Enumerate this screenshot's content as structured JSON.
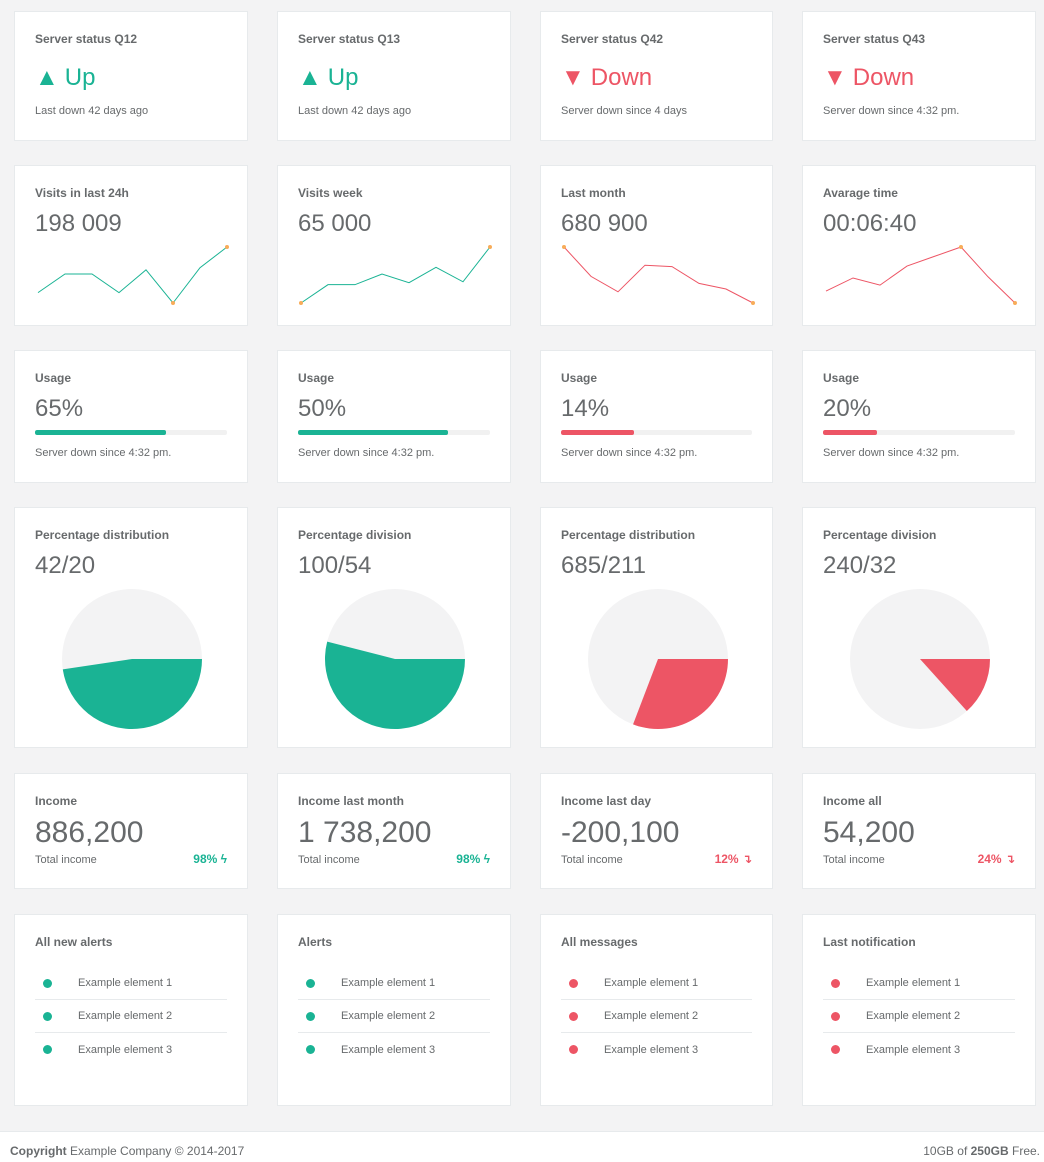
{
  "colors": {
    "up": "#1ab394",
    "down": "#ed5565",
    "dot": "#f8ac59",
    "track": "#f1f1f1",
    "pie_bg": "#f3f3f4"
  },
  "status": [
    {
      "title": "Server status Q12",
      "state": "Up",
      "dir": "up",
      "note": "Last down 42 days ago"
    },
    {
      "title": "Server status Q13",
      "state": "Up",
      "dir": "up",
      "note": "Last down 42 days ago"
    },
    {
      "title": "Server status Q42",
      "state": "Down",
      "dir": "down",
      "note": "Server down since 4 days"
    },
    {
      "title": "Server status Q43",
      "state": "Down",
      "dir": "down",
      "note": "Server down since 4:32 pm."
    }
  ],
  "visits": [
    {
      "title": "Visits in last 24h",
      "value": "198 009",
      "dir": "up",
      "points": [
        34,
        43,
        43,
        34,
        45,
        29,
        46,
        56
      ]
    },
    {
      "title": "Visits week",
      "value": "65 000",
      "dir": "up",
      "points": [
        24,
        43,
        43,
        54,
        45,
        61,
        46,
        82
      ]
    },
    {
      "title": "Last month",
      "value": "680 900",
      "dir": "down",
      "points": [
        77,
        56,
        45,
        64,
        63,
        51,
        47,
        37
      ]
    },
    {
      "title": "Avarage time",
      "value": "00:06:40",
      "dir": "down",
      "points": [
        34,
        45,
        39,
        55,
        63,
        71,
        46,
        24
      ]
    }
  ],
  "usage": [
    {
      "title": "Usage",
      "value": "65%",
      "percent": 68,
      "dir": "up",
      "note": "Server down since 4:32 pm."
    },
    {
      "title": "Usage",
      "value": "50%",
      "percent": 78,
      "dir": "up",
      "note": "Server down since 4:32 pm."
    },
    {
      "title": "Usage",
      "value": "14%",
      "percent": 38,
      "dir": "down",
      "note": "Server down since 4:32 pm."
    },
    {
      "title": "Usage",
      "value": "20%",
      "percent": 28,
      "dir": "down",
      "note": "Server down since 4:32 pm."
    }
  ],
  "pies": [
    {
      "title": "Percentage distribution",
      "value": "42/20",
      "a": 42,
      "b": 20,
      "dir": "up"
    },
    {
      "title": "Percentage division",
      "value": "100/54",
      "a": 100,
      "b": 54,
      "dir": "up"
    },
    {
      "title": "Percentage distribution",
      "value": "685/211",
      "a": 685,
      "b": 211,
      "dir": "down"
    },
    {
      "title": "Percentage division",
      "value": "240/32",
      "a": 240,
      "b": 32,
      "dir": "down"
    }
  ],
  "income": [
    {
      "title": "Income",
      "value": "886,200",
      "label": "Total income",
      "pct": "98%",
      "dir": "up"
    },
    {
      "title": "Income last month",
      "value": "1 738,200",
      "label": "Total income",
      "pct": "98%",
      "dir": "up"
    },
    {
      "title": "Income last day",
      "value": "-200,100",
      "label": "Total income",
      "pct": "12%",
      "dir": "down"
    },
    {
      "title": "Income all",
      "value": "54,200",
      "label": "Total income",
      "pct": "24%",
      "dir": "down"
    }
  ],
  "lists": [
    {
      "title": "All new alerts",
      "dir": "up",
      "items": [
        "Example element 1",
        "Example element 2",
        "Example element 3"
      ]
    },
    {
      "title": "Alerts",
      "dir": "up",
      "items": [
        "Example element 1",
        "Example element 2",
        "Example element 3"
      ]
    },
    {
      "title": "All messages",
      "dir": "down",
      "items": [
        "Example element 1",
        "Example element 2",
        "Example element 3"
      ]
    },
    {
      "title": "Last notification",
      "dir": "down",
      "items": [
        "Example element 1",
        "Example element 2",
        "Example element 3"
      ]
    }
  ],
  "footer": {
    "copyright_bold": "Copyright",
    "copyright_text": " Example Company © 2014-2017",
    "storage_used": "10GB",
    "storage_of": " of ",
    "storage_total": "250GB",
    "storage_free": " Free."
  }
}
